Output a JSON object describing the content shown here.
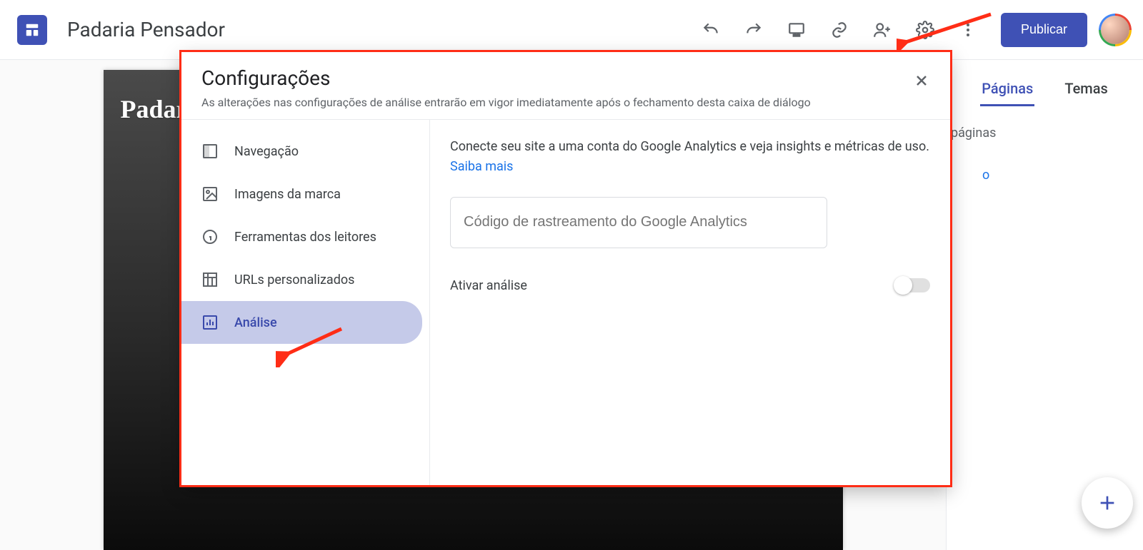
{
  "topbar": {
    "doc_title": "Padaria Pensador",
    "publish_label": "Publicar"
  },
  "canvas": {
    "site_title": "Padaria Pensador"
  },
  "sidepanel": {
    "tabs": {
      "pages": "Páginas",
      "themes": "Temas",
      "active": "pages"
    },
    "sublabel_fragment": "páginas",
    "letter_fragment": "o"
  },
  "dialog": {
    "title": "Configurações",
    "subtitle": "As alterações nas configurações de análise entrarão em vigor imediatamente após o fechamento desta caixa de diálogo",
    "nav": {
      "items": [
        {
          "id": "navegacao",
          "label": "Navegação"
        },
        {
          "id": "imagens",
          "label": "Imagens da marca"
        },
        {
          "id": "ferramentas",
          "label": "Ferramentas dos leitores"
        },
        {
          "id": "urls",
          "label": "URLs personalizados"
        },
        {
          "id": "analise",
          "label": "Análise"
        }
      ],
      "active": "analise"
    },
    "content": {
      "description": "Conecte seu site a uma conta do Google Analytics e veja insights e métricas de uso. ",
      "learn_more": "Saiba mais",
      "tracking_placeholder": "Código de rastreamento do Google Analytics",
      "enable_label": "Ativar análise",
      "enable_value": false
    }
  },
  "colors": {
    "accent": "#3f51b5",
    "annotation": "#ff2d16",
    "link": "#1a73e8",
    "border": "#e8eaed",
    "muted": "#5f6368"
  }
}
